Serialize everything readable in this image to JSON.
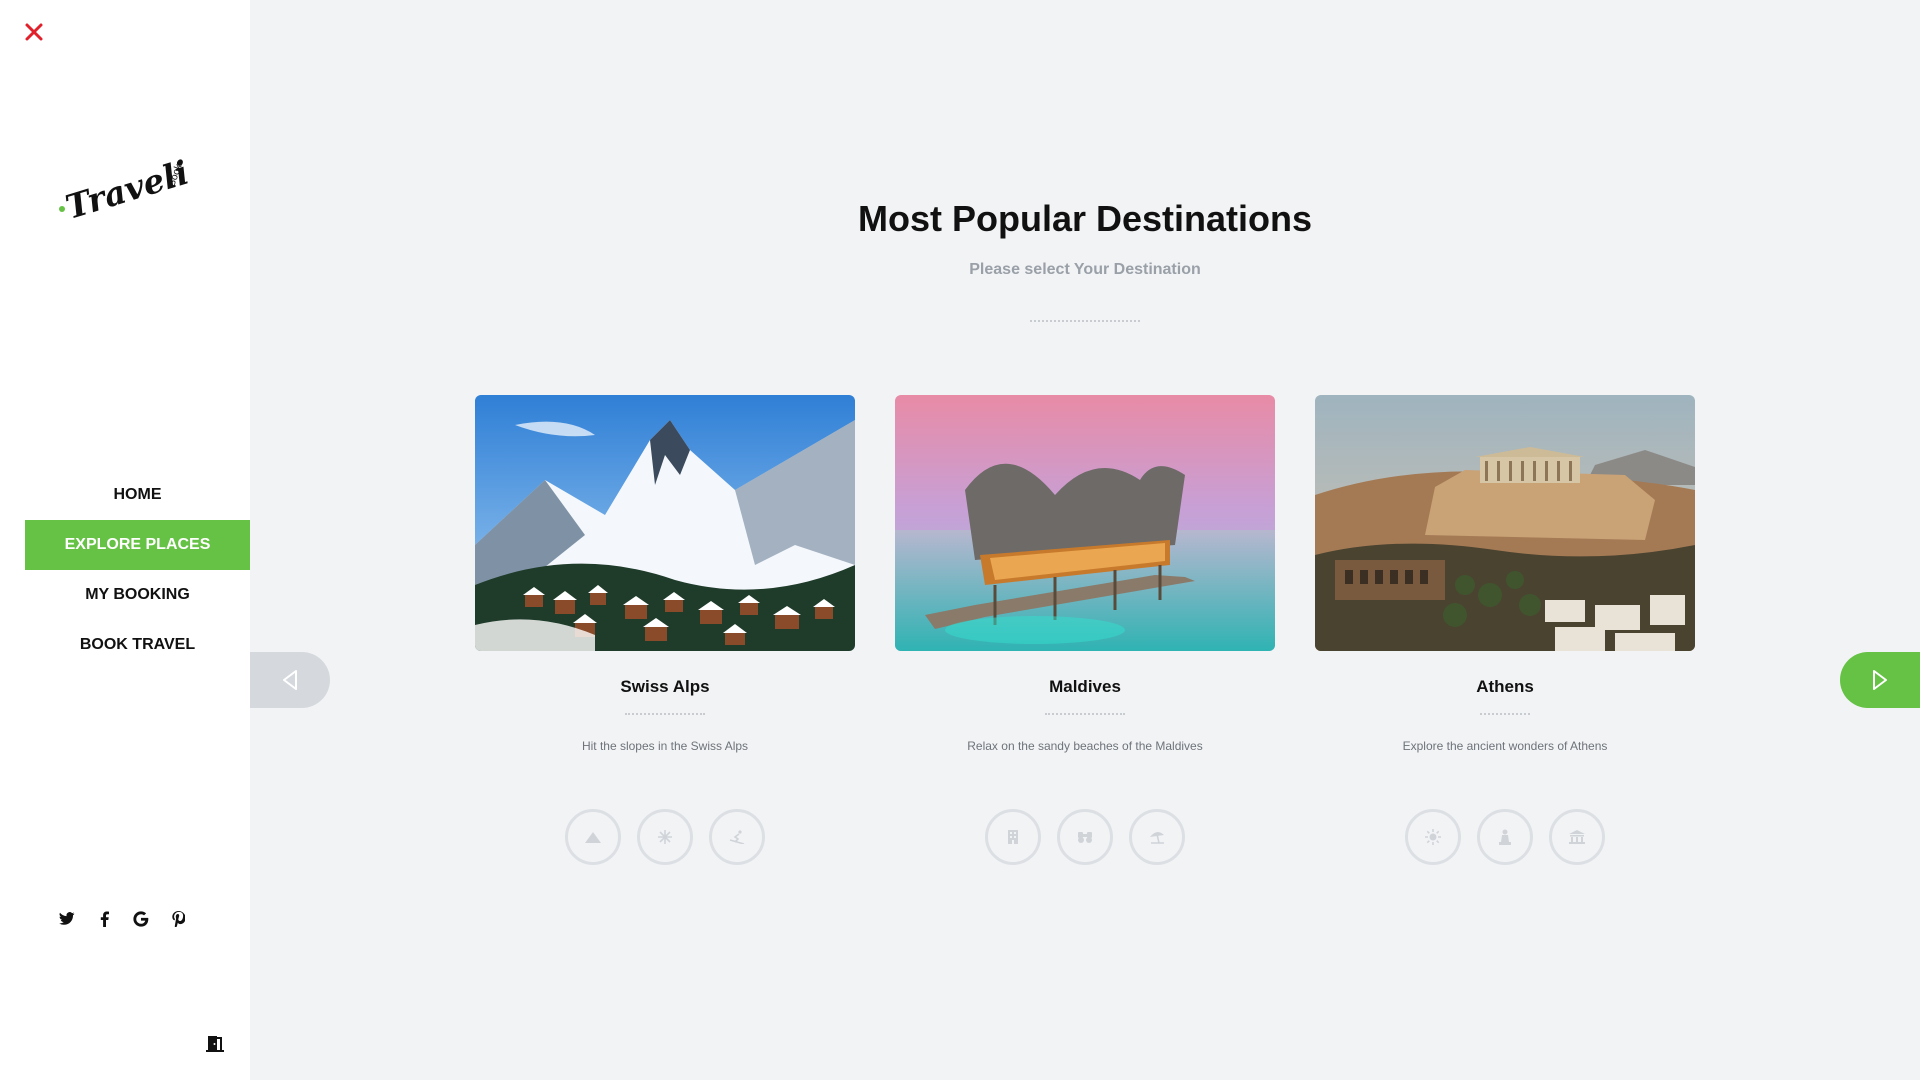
{
  "brand": {
    "logo_text": "Traveli",
    "logo_sub": "Book",
    "accent_color": "#66c245",
    "close_color": "#e0202b"
  },
  "nav": {
    "items": [
      {
        "label": "HOME",
        "active": false
      },
      {
        "label": "EXPLORE PLACES",
        "active": true
      },
      {
        "label": "MY BOOKING",
        "active": false
      },
      {
        "label": "BOOK TRAVEL",
        "active": false
      }
    ]
  },
  "social": [
    "twitter-icon",
    "facebook-icon",
    "google-icon",
    "pinterest-icon"
  ],
  "header": {
    "title": "Most Popular Destinations",
    "subtitle": "Please select Your Destination"
  },
  "destinations": [
    {
      "name": "Swiss Alps",
      "description": "Hit the slopes in the Swiss Alps",
      "icons": [
        "mountain-icon",
        "snowflake-icon",
        "skiing-icon"
      ]
    },
    {
      "name": "Maldives",
      "description": "Relax on the sandy beaches of the Maldives",
      "icons": [
        "hotel-icon",
        "binoculars-icon",
        "beach-umbrella-icon"
      ]
    },
    {
      "name": "Athens",
      "description": "Explore the ancient wonders of Athens",
      "icons": [
        "sun-icon",
        "statue-icon",
        "museum-icon"
      ]
    }
  ],
  "carousel": {
    "prev_icon": "triangle-left-icon",
    "next_icon": "triangle-right-icon"
  }
}
